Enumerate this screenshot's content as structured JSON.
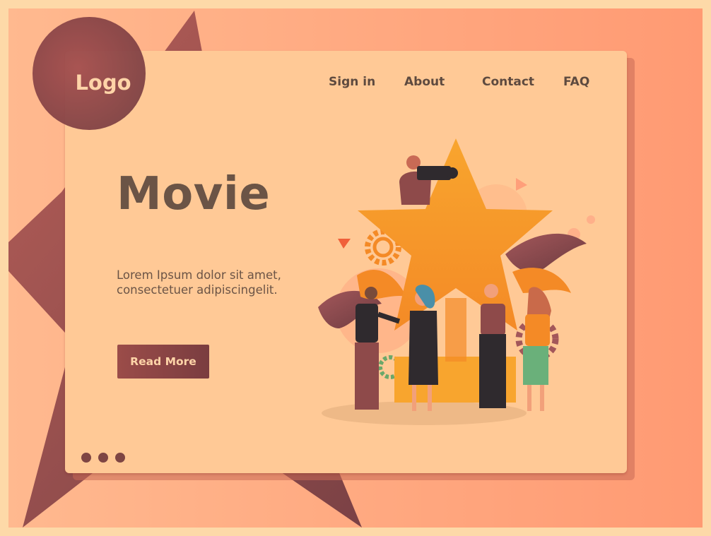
{
  "header": {
    "logo": "Logo",
    "nav": [
      "Sign in",
      "About",
      "Contact",
      "FAQ"
    ]
  },
  "hero": {
    "title": "Movie",
    "text_line1": "Lorem Ipsum dolor sit amet,",
    "text_line2": "consectetuer adipiscingelit.",
    "button": "Read More"
  },
  "pagination": {
    "dots": 3
  },
  "colors": {
    "background": "#ff9a73",
    "card": "#ffc996",
    "accent": "#7e4543",
    "text": "#6b5446",
    "button_text": "#ffd4a8"
  },
  "icons": [
    "star-icon",
    "gear-icon",
    "camera-icon",
    "triangle-icon"
  ]
}
